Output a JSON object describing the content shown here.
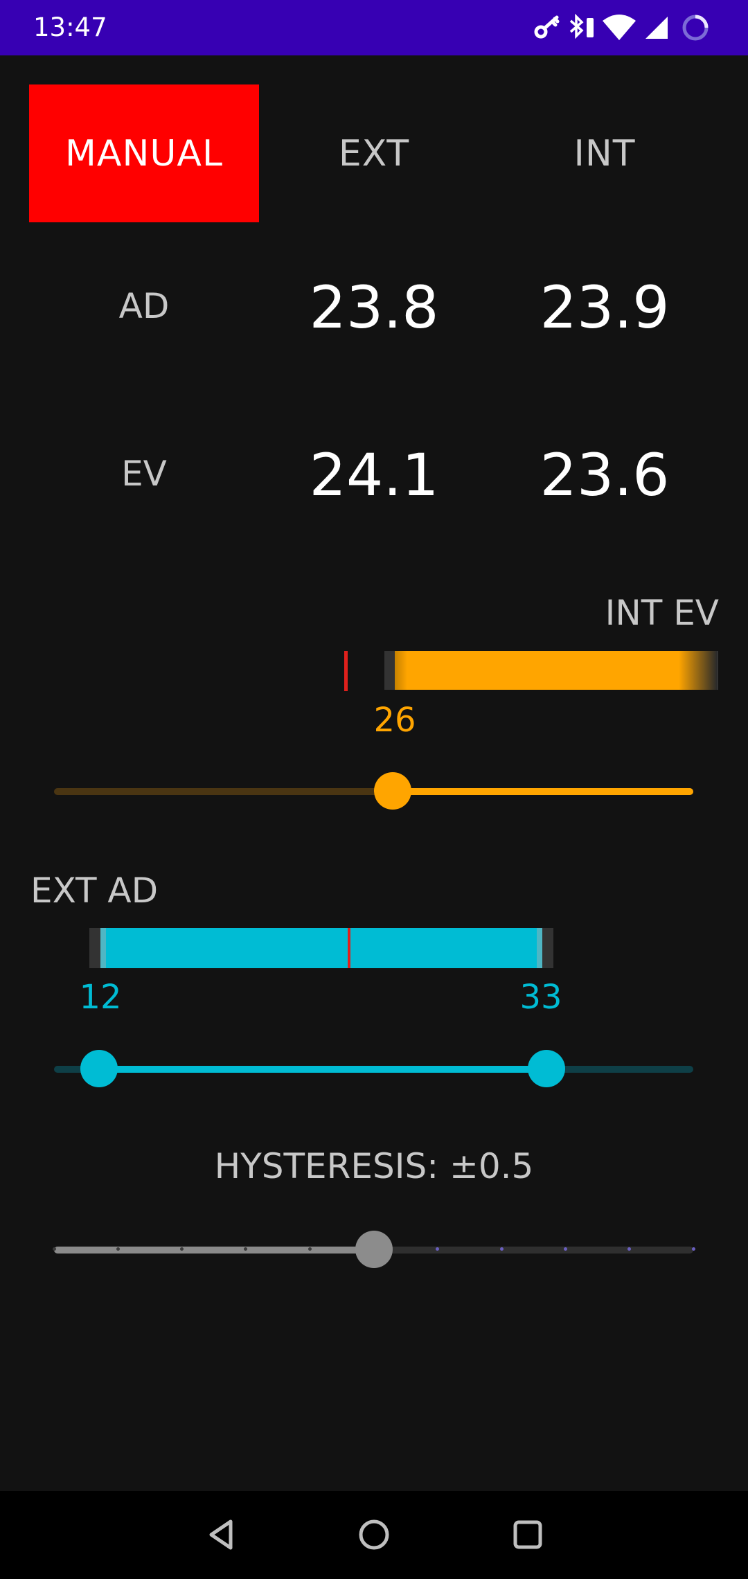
{
  "status_bar": {
    "time": "13:47",
    "icons": [
      "key-icon",
      "bluetooth-battery-icon",
      "wifi-icon",
      "signal-icon",
      "loading-ring-icon"
    ],
    "background": "#3700b3"
  },
  "tabs": [
    {
      "label": "MANUAL",
      "active": true
    },
    {
      "label": "EXT",
      "active": false
    },
    {
      "label": "INT",
      "active": false
    }
  ],
  "readings": {
    "ad": {
      "label": "AD",
      "ext": "23.8",
      "int": "23.9"
    },
    "ev": {
      "label": "EV",
      "ext": "24.1",
      "int": "23.6"
    }
  },
  "int_ev": {
    "label": "INT EV",
    "value_label": "26",
    "slider_fraction": 0.53,
    "color": "#ffa500"
  },
  "ext_ad": {
    "label": "EXT AD",
    "min_label": "12",
    "max_label": "33",
    "slider_min_fraction": 0.07,
    "slider_max_fraction": 0.77,
    "color": "#00bcd4"
  },
  "hysteresis": {
    "label": "HYSTERESIS: ±0.5",
    "steps": 10,
    "selected_step": 5
  },
  "marker_color": "#e0201c",
  "nav_bar": {
    "icons": [
      "back-icon",
      "home-icon",
      "recents-icon"
    ]
  }
}
